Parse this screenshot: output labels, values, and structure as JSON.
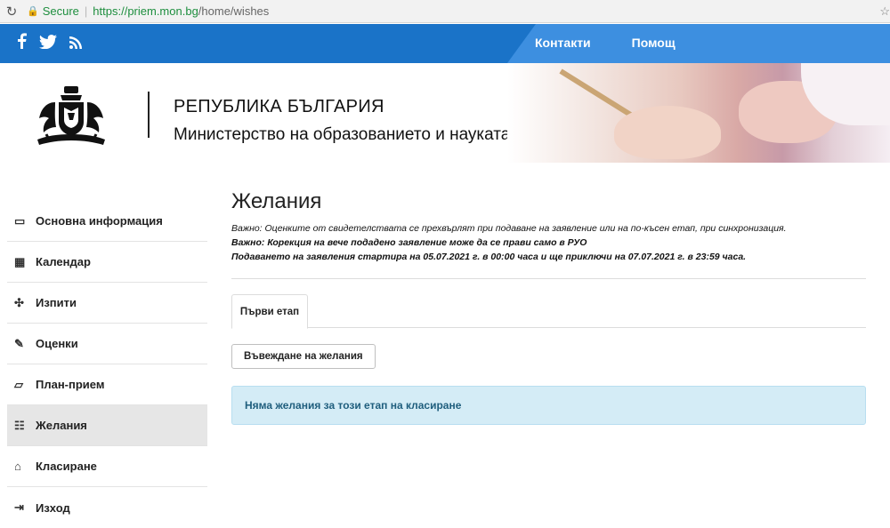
{
  "browser": {
    "secure_label": "Secure",
    "url_host": "https://priem.mon.bg",
    "url_path": "/home/wishes"
  },
  "topbar": {
    "social": [
      {
        "icon": "facebook-icon",
        "glyph": "f"
      },
      {
        "icon": "twitter-icon",
        "glyph": "🐦"
      },
      {
        "icon": "rss-icon",
        "glyph": "◎"
      }
    ],
    "nav": [
      {
        "label": "Контакти"
      },
      {
        "label": "Помощ"
      }
    ],
    "colors": {
      "bar": "#1a73c8",
      "bar_light": "#3d8fe0"
    }
  },
  "header": {
    "org_line1": "РЕПУБЛИКА БЪЛГАРИЯ",
    "org_line2": "Министерство на образованието и науката"
  },
  "sidebar": {
    "items": [
      {
        "icon": "monitor-icon",
        "glyph": "▭",
        "label": "Основна информация"
      },
      {
        "icon": "calendar-icon",
        "glyph": "▦",
        "label": "Календар"
      },
      {
        "icon": "puzzle-icon",
        "glyph": "✣",
        "label": "Изпити"
      },
      {
        "icon": "edit-icon",
        "glyph": "✎",
        "label": "Оценки"
      },
      {
        "icon": "folder-icon",
        "glyph": "▱",
        "label": "План-прием"
      },
      {
        "icon": "list-icon",
        "glyph": "☷",
        "label": "Желания",
        "active": true
      },
      {
        "icon": "bank-icon",
        "glyph": "⌂",
        "label": "Класиране"
      },
      {
        "icon": "logout-icon",
        "glyph": "⇥",
        "label": "Изход"
      }
    ]
  },
  "main": {
    "title": "Желания",
    "notes": [
      "Важно: Оценките от свидетелствата се прехвърлят при подаване на заявление или на по-късен етап, при синхронизация.",
      "Важно: Корекция на вече подадено заявление може да се прави само в РУО",
      "Подаването на заявления стартира на 05.07.2021 г. в 00:00 часа и ще приключи на 07.07.2021 г. в 23:59 часа."
    ],
    "tab_label": "Първи етап",
    "button_label": "Въвеждане на желания",
    "alert_text": "Няма желания за този етап на класиране",
    "colors": {
      "alert_bg": "#d4ecf6",
      "alert_text": "#1f5e7d"
    }
  }
}
